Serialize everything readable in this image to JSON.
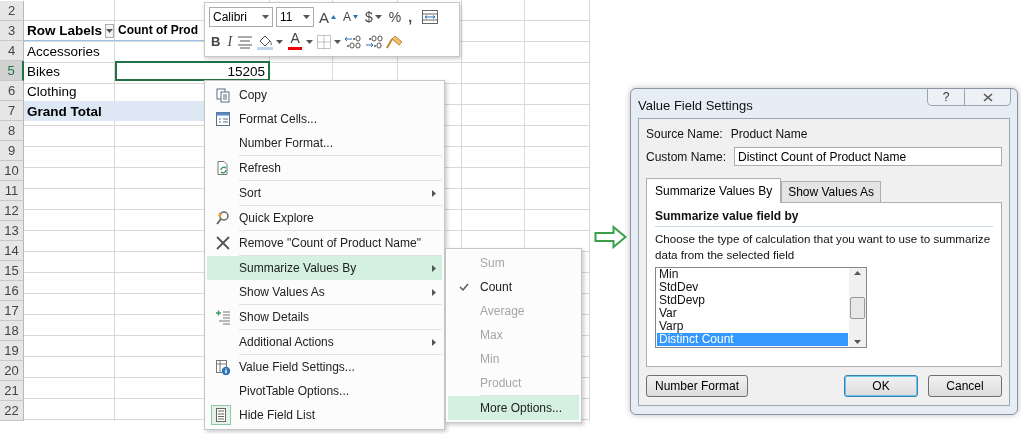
{
  "sheet": {
    "rows": [
      {
        "row": "2",
        "selected": false,
        "kind": "plain",
        "cells": []
      },
      {
        "row": "3",
        "selected": false,
        "kind": "header",
        "cells": [
          {
            "text": "Row Labels",
            "filter": true,
            "selected": false
          },
          {
            "text": "Count of Prod",
            "filter": false,
            "selected": false
          }
        ]
      },
      {
        "row": "4",
        "selected": false,
        "kind": "plain",
        "cells": [
          {
            "text": "Accessories",
            "filter": false,
            "selected": false
          }
        ]
      },
      {
        "row": "5",
        "selected": true,
        "kind": "plain",
        "cells": [
          {
            "text": "Bikes",
            "filter": false,
            "selected": false
          },
          {
            "text": "15205",
            "filter": false,
            "selected": true
          }
        ]
      },
      {
        "row": "6",
        "selected": false,
        "kind": "plain",
        "cells": [
          {
            "text": "Clothing",
            "filter": false,
            "selected": false
          }
        ]
      },
      {
        "row": "7",
        "selected": false,
        "kind": "total",
        "cells": [
          {
            "text": "Grand Total",
            "filter": false,
            "selected": false
          }
        ]
      },
      {
        "row": "8",
        "selected": false,
        "kind": "plain",
        "cells": []
      },
      {
        "row": "9",
        "selected": false,
        "kind": "plain",
        "cells": []
      },
      {
        "row": "10",
        "selected": false,
        "kind": "plain",
        "cells": []
      },
      {
        "row": "11",
        "selected": false,
        "kind": "plain",
        "cells": []
      },
      {
        "row": "12",
        "selected": false,
        "kind": "plain",
        "cells": []
      },
      {
        "row": "13",
        "selected": false,
        "kind": "plain",
        "cells": []
      },
      {
        "row": "14",
        "selected": false,
        "kind": "plain",
        "cells": []
      },
      {
        "row": "15",
        "selected": false,
        "kind": "plain",
        "cells": []
      },
      {
        "row": "16",
        "selected": false,
        "kind": "plain",
        "cells": []
      },
      {
        "row": "17",
        "selected": false,
        "kind": "plain",
        "cells": []
      },
      {
        "row": "18",
        "selected": false,
        "kind": "plain",
        "cells": []
      },
      {
        "row": "19",
        "selected": false,
        "kind": "plain",
        "cells": []
      },
      {
        "row": "20",
        "selected": false,
        "kind": "plain",
        "cells": []
      },
      {
        "row": "21",
        "selected": false,
        "kind": "plain",
        "cells": []
      },
      {
        "row": "22",
        "selected": false,
        "kind": "plain",
        "cells": []
      }
    ]
  },
  "mini_toolbar": {
    "font": "Calibri",
    "size": "11",
    "top_buttons": [
      {
        "label": "A"
      },
      {
        "label": "A"
      },
      {
        "label": "$"
      },
      {
        "label": "%"
      },
      {
        "label": ","
      }
    ],
    "bottom_buttons": [
      {
        "label": "B"
      },
      {
        "label": "I"
      },
      {
        "label": "A"
      }
    ]
  },
  "context_menu": {
    "groups": [
      [
        {
          "label": "Copy",
          "submenu": false,
          "selected": false,
          "checked": false
        },
        {
          "label": "Format Cells...",
          "submenu": false,
          "selected": false,
          "checked": false
        },
        {
          "label": "Number Format...",
          "submenu": false,
          "selected": false,
          "checked": false
        }
      ],
      [
        {
          "label": "Refresh",
          "submenu": false,
          "selected": false,
          "checked": false
        }
      ],
      [
        {
          "label": "Sort",
          "submenu": true,
          "selected": false,
          "checked": false
        }
      ],
      [
        {
          "label": "Quick Explore",
          "submenu": false,
          "selected": false,
          "checked": false
        }
      ],
      [
        {
          "label": "Remove \"Count of Product Name\"",
          "submenu": false,
          "selected": false,
          "checked": false
        }
      ],
      [
        {
          "label": "Summarize Values By",
          "submenu": true,
          "selected": true,
          "checked": false
        },
        {
          "label": "Show Values As",
          "submenu": true,
          "selected": false,
          "checked": false
        }
      ],
      [
        {
          "label": "Show Details",
          "submenu": false,
          "selected": false,
          "checked": false
        }
      ],
      [
        {
          "label": "Additional Actions",
          "submenu": true,
          "selected": false,
          "checked": false
        }
      ],
      [
        {
          "label": "Value Field Settings...",
          "submenu": false,
          "selected": false,
          "checked": false
        },
        {
          "label": "PivotTable Options...",
          "submenu": false,
          "selected": false,
          "checked": false
        },
        {
          "label": "Hide Field List",
          "submenu": false,
          "selected": false,
          "checked": true
        }
      ]
    ]
  },
  "submenu": {
    "groups": [
      [
        {
          "label": "Sum",
          "checked": false,
          "disabled": true,
          "selected": false
        },
        {
          "label": "Count",
          "checked": true,
          "disabled": false,
          "selected": false
        },
        {
          "label": "Average",
          "checked": false,
          "disabled": true,
          "selected": false
        },
        {
          "label": "Max",
          "checked": false,
          "disabled": true,
          "selected": false
        },
        {
          "label": "Min",
          "checked": false,
          "disabled": true,
          "selected": false
        },
        {
          "label": "Product",
          "checked": false,
          "disabled": true,
          "selected": false
        }
      ],
      [
        {
          "label": "More Options...",
          "checked": false,
          "disabled": false,
          "selected": true
        }
      ]
    ]
  },
  "dialog": {
    "title": "Value Field Settings",
    "help": "?",
    "source_label": "Source Name:",
    "source_value": "Product Name",
    "custom_label": "Custom Name:",
    "custom_value": "Distinct Count of Product Name",
    "tabs": [
      {
        "label": "Summarize Values By",
        "selected": true
      },
      {
        "label": "Show Values As",
        "selected": false
      }
    ],
    "section_title": "Summarize value field by",
    "description": "Choose the type of calculation that you want to use to summarize data from the selected field",
    "functions": [
      {
        "label": "Min",
        "selected": false
      },
      {
        "label": "StdDev",
        "selected": false
      },
      {
        "label": "StdDevp",
        "selected": false
      },
      {
        "label": "Var",
        "selected": false
      },
      {
        "label": "Varp",
        "selected": false
      },
      {
        "label": "Distinct Count",
        "selected": true
      }
    ],
    "buttons": [
      {
        "label": "Number Format",
        "kind": "secondary"
      },
      {
        "label": "OK",
        "kind": "default"
      },
      {
        "label": "Cancel",
        "kind": "secondary"
      }
    ]
  }
}
